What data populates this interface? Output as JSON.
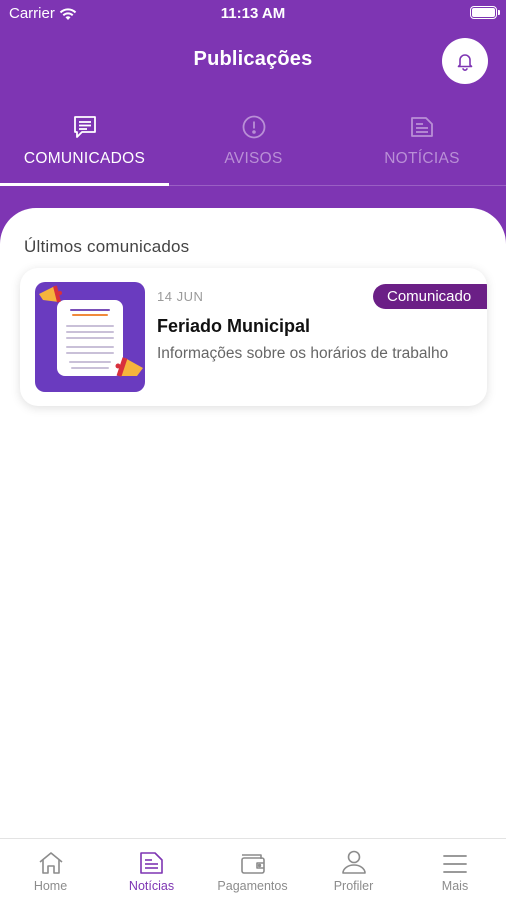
{
  "status_bar": {
    "carrier": "Carrier",
    "time": "11:13 AM"
  },
  "header": {
    "title": "Publicações",
    "notification_icon": "bell-icon"
  },
  "tabs": [
    {
      "label": "COMUNICADOS",
      "icon": "chat-bubble-icon",
      "active": true
    },
    {
      "label": "AVISOS",
      "icon": "alert-circle-icon",
      "active": false
    },
    {
      "label": "NOTÍCIAS",
      "icon": "document-icon",
      "active": false
    }
  ],
  "main": {
    "section_title": "Últimos comunicados",
    "items": [
      {
        "date": "14 JUN",
        "title": "Feriado Municipal",
        "subtitle": "Informações sobre os horários de trabalho",
        "badge": "Comunicado"
      }
    ]
  },
  "bottom_nav": [
    {
      "label": "Home",
      "icon": "home-icon",
      "active": false
    },
    {
      "label": "Notícias",
      "icon": "news-icon",
      "active": true
    },
    {
      "label": "Pagamentos",
      "icon": "wallet-icon",
      "active": false
    },
    {
      "label": "Profiler",
      "icon": "user-icon",
      "active": false
    },
    {
      "label": "Mais",
      "icon": "menu-icon",
      "active": false
    }
  ],
  "colors": {
    "primary": "#7e35b3",
    "badge": "#6b1f86",
    "inactive_tab": "#b98fd6",
    "nav_inactive": "#8c8c8c"
  }
}
